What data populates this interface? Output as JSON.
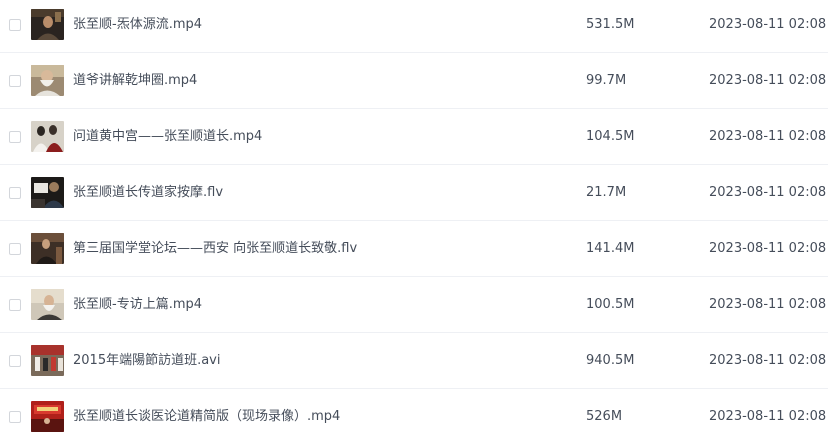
{
  "files": [
    {
      "name": "张至顺-炁体源流.mp4",
      "size": "531.5M",
      "modified": "2023-08-11 02:08",
      "thumb": "thumbnail-portrait-dark"
    },
    {
      "name": "道爷讲解乾坤圈.mp4",
      "size": "99.7M",
      "modified": "2023-08-11 02:08",
      "thumb": "thumbnail-elder-white-beard"
    },
    {
      "name": "问道黄中宫——张至顺道长.mp4",
      "size": "104.5M",
      "modified": "2023-08-11 02:08",
      "thumb": "thumbnail-group-gathering"
    },
    {
      "name": "张至顺道长传道家按摩.flv",
      "size": "21.7M",
      "modified": "2023-08-11 02:08",
      "thumb": "thumbnail-massage-demo"
    },
    {
      "name": "第三届国学堂论坛——西安 向张至顺道长致敬.flv",
      "size": "141.4M",
      "modified": "2023-08-11 02:08",
      "thumb": "thumbnail-forum-stage"
    },
    {
      "name": "张至顺-专访上篇.mp4",
      "size": "100.5M",
      "modified": "2023-08-11 02:08",
      "thumb": "thumbnail-interview-elder"
    },
    {
      "name": "2015年端陽節訪道班.avi",
      "size": "940.5M",
      "modified": "2023-08-11 02:08",
      "thumb": "thumbnail-crowd-festival"
    },
    {
      "name": "张至顺道长谈医论道精简版（现场录像）.mp4",
      "size": "526M",
      "modified": "2023-08-11 02:08",
      "thumb": "thumbnail-red-stage"
    }
  ]
}
